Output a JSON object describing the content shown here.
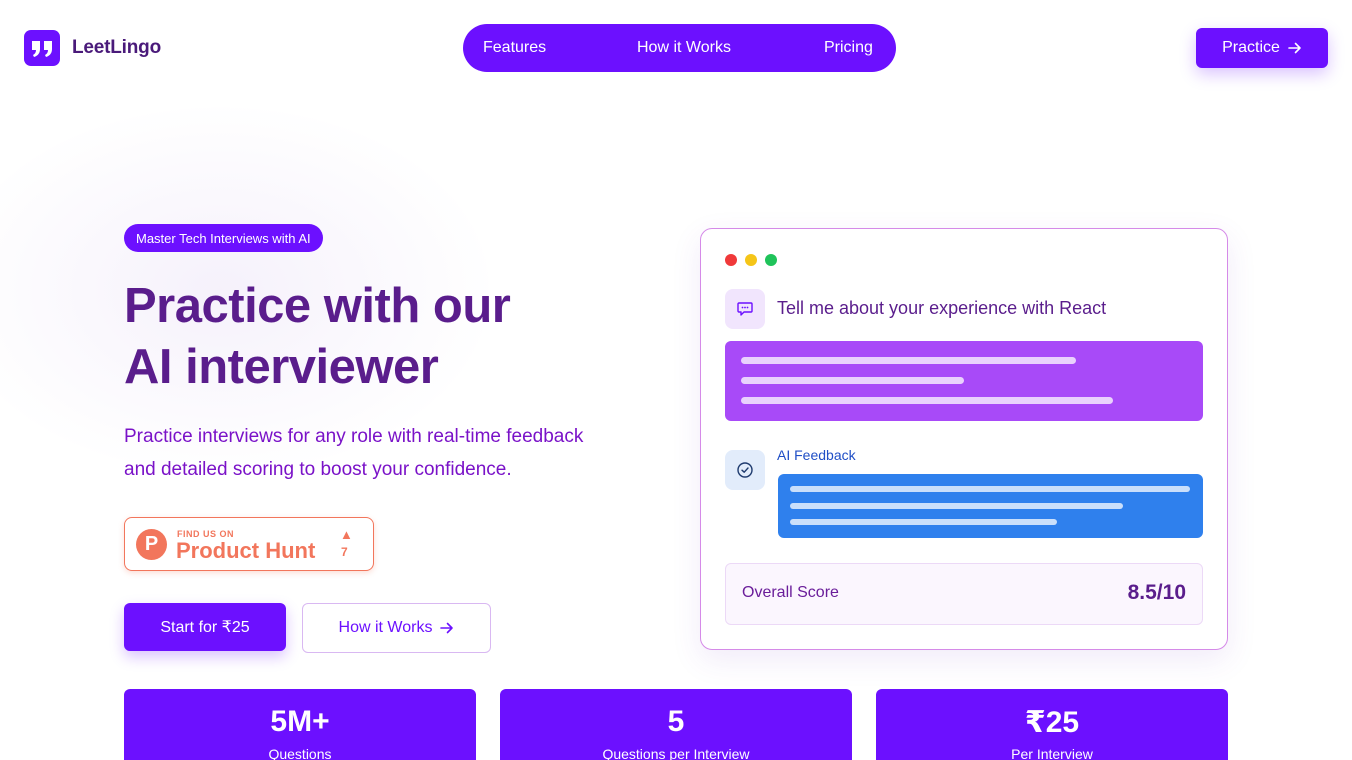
{
  "brand": {
    "name": "LeetLingo"
  },
  "nav": {
    "links": [
      "Features",
      "How it Works",
      "Pricing"
    ],
    "cta_label": "Practice"
  },
  "hero": {
    "badge": "Master Tech Interviews with AI",
    "title_line1": "Practice with our",
    "title_line2": "AI interviewer",
    "subtitle_line1": "Practice interviews for any role with real-time feedback",
    "subtitle_line2": "and detailed scoring to boost your confidence.",
    "product_hunt": {
      "find_text": "FIND US ON",
      "name": "Product Hunt",
      "upvotes": "7"
    },
    "primary_button": "Start for ₹25",
    "secondary_button": "How it Works"
  },
  "demo_card": {
    "question": "Tell me about your experience with React",
    "feedback_label": "AI Feedback",
    "score_label": "Overall Score",
    "score_value": "8.5/10"
  },
  "stats": [
    {
      "value": "5M+",
      "label": "Questions"
    },
    {
      "value": "5",
      "label": "Questions per Interview"
    },
    {
      "value": "₹25",
      "label": "Per Interview"
    }
  ],
  "colors": {
    "primary": "#6c10ff",
    "heading": "#5a1d8c",
    "answer_bubble": "#a84af8",
    "feedback_bubble": "#2f80ed",
    "product_hunt": "#f2765c"
  }
}
